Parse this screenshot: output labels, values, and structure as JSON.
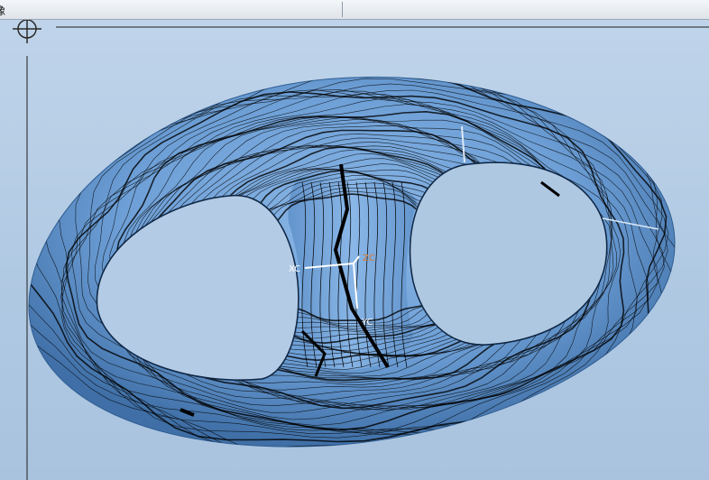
{
  "window": {
    "title_fragment": "像"
  },
  "viewport": {
    "background_top": "#bfd4ea",
    "background_bottom": "#a9c3df",
    "model_color": "#6d9fd6",
    "contour_color": "#000000"
  },
  "triad": {
    "x_label": "XC",
    "y_label": "YC",
    "z_label": "ZC",
    "z_label_color": "#d9782b"
  },
  "icons": {
    "crosshair": "crosshair-icon"
  }
}
